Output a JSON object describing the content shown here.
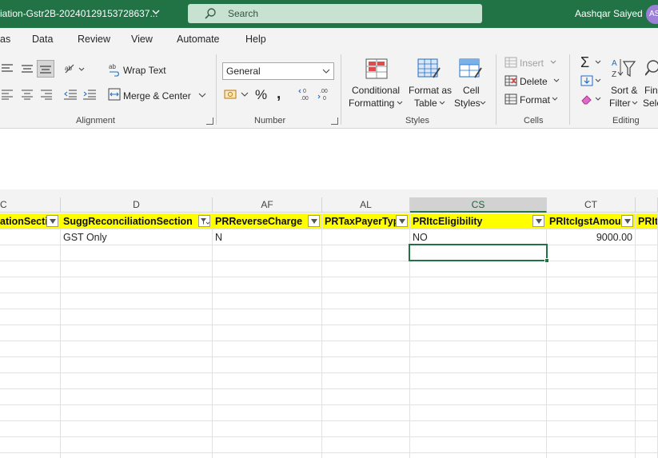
{
  "titlebar": {
    "filename": "iation-Gstr2B-20240129153728637...",
    "search_placeholder": "Search",
    "user_name": "Aashqar Saiyed",
    "avatar_initials": "AS"
  },
  "menu": {
    "tabs": [
      "as",
      "Data",
      "Review",
      "View",
      "Automate",
      "Help"
    ]
  },
  "ribbon": {
    "alignment": {
      "wrap_text": "Wrap Text",
      "merge_center": "Merge & Center",
      "group_label": "Alignment"
    },
    "number": {
      "format_value": "General",
      "group_label": "Number"
    },
    "styles": {
      "conditional_line1": "Conditional",
      "conditional_line2": "Formatting",
      "format_as_line1": "Format as",
      "format_as_line2": "Table",
      "cell_line1": "Cell",
      "cell_line2": "Styles",
      "group_label": "Styles"
    },
    "cells": {
      "insert": "Insert",
      "delete": "Delete",
      "format": "Format",
      "group_label": "Cells"
    },
    "editing": {
      "sort_line1": "Sort &",
      "sort_line2": "Filter",
      "find_line1": "Fin",
      "find_line2": "Sele",
      "group_label": "Editing"
    }
  },
  "grid": {
    "column_letters": [
      "C",
      "D",
      "AF",
      "AL",
      "CS",
      "CT",
      ""
    ],
    "header_row": [
      "ationSectic",
      "SuggReconciliationSection",
      "PRReverseCharge",
      "PRTaxPayerTyp",
      "PRItcEligibility",
      "PRItcIgstAmou",
      "PRIt"
    ],
    "data_row": [
      "",
      "GST Only",
      "N",
      "",
      "NO",
      "9000.00",
      ""
    ]
  },
  "colors": {
    "excel_green": "#217346",
    "header_fill": "#ffff00"
  }
}
